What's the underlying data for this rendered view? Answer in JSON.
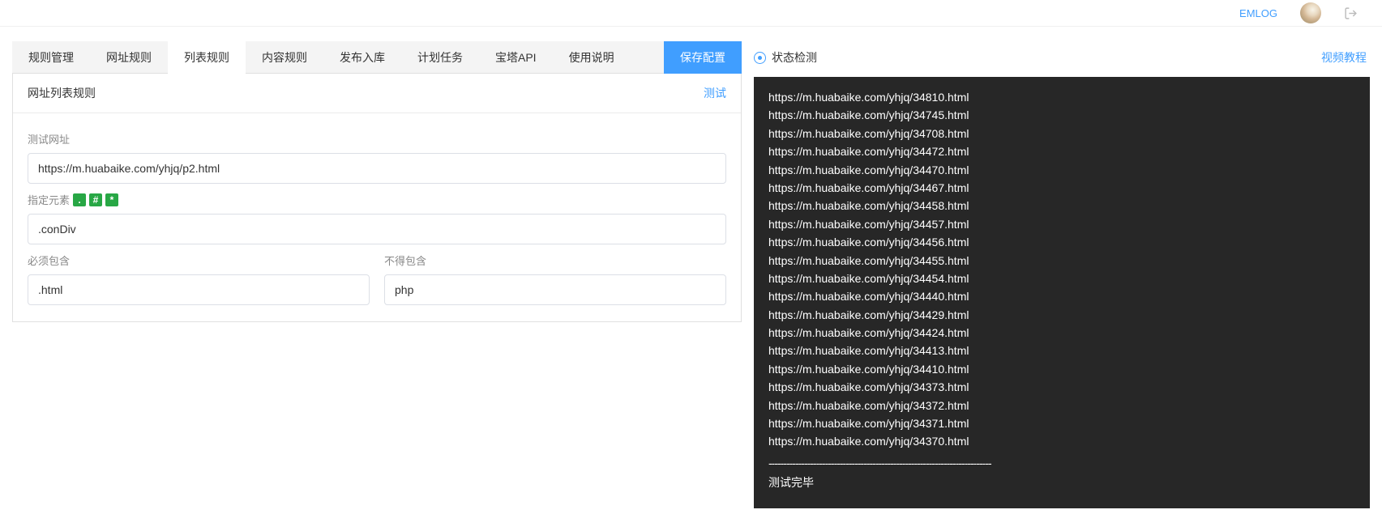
{
  "topbar": {
    "brand": "EMLOG"
  },
  "tabs": {
    "items": [
      {
        "label": "规则管理"
      },
      {
        "label": "网址规则"
      },
      {
        "label": "列表规则"
      },
      {
        "label": "内容规则"
      },
      {
        "label": "发布入库"
      },
      {
        "label": "计划任务"
      },
      {
        "label": "宝塔API"
      },
      {
        "label": "使用说明"
      }
    ],
    "active_index": 2,
    "save_label": "保存配置"
  },
  "panel": {
    "title": "网址列表规则",
    "test_link": "测试",
    "test_url_label": "测试网址",
    "test_url_value": "https://m.huabaike.com/yhjq/p2.html",
    "element_label": "指定元素",
    "element_chips": [
      ".",
      "#",
      "*"
    ],
    "element_value": ".conDiv",
    "must_include_label": "必须包含",
    "must_include_value": ".html",
    "must_exclude_label": "不得包含",
    "must_exclude_value": "php"
  },
  "status": {
    "label": "状态检测",
    "video_link": "视频教程",
    "lines": [
      "https://m.huabaike.com/yhjq/34810.html",
      "https://m.huabaike.com/yhjq/34745.html",
      "https://m.huabaike.com/yhjq/34708.html",
      "https://m.huabaike.com/yhjq/34472.html",
      "https://m.huabaike.com/yhjq/34470.html",
      "https://m.huabaike.com/yhjq/34467.html",
      "https://m.huabaike.com/yhjq/34458.html",
      "https://m.huabaike.com/yhjq/34457.html",
      "https://m.huabaike.com/yhjq/34456.html",
      "https://m.huabaike.com/yhjq/34455.html",
      "https://m.huabaike.com/yhjq/34454.html",
      "https://m.huabaike.com/yhjq/34440.html",
      "https://m.huabaike.com/yhjq/34429.html",
      "https://m.huabaike.com/yhjq/34424.html",
      "https://m.huabaike.com/yhjq/34413.html",
      "https://m.huabaike.com/yhjq/34410.html",
      "https://m.huabaike.com/yhjq/34373.html",
      "https://m.huabaike.com/yhjq/34372.html",
      "https://m.huabaike.com/yhjq/34371.html",
      "https://m.huabaike.com/yhjq/34370.html"
    ],
    "separator": "---------------------------------------------------------------------------",
    "done": "测试完毕"
  }
}
